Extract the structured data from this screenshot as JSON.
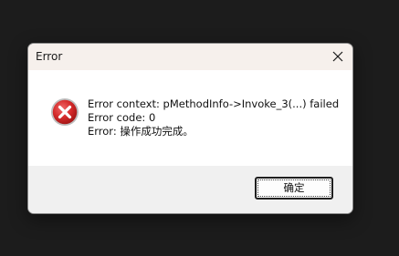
{
  "dialog": {
    "title": "Error",
    "icons": {
      "close": "close-icon",
      "status": "error-icon"
    },
    "colors": {
      "error_red": "#d32f2f",
      "titlebar": "#f6f0ec",
      "footer": "#f0f0f0"
    },
    "message": {
      "line1": "Error context: pMethodInfo->Invoke_3(...) failed",
      "line2": "Error code: 0",
      "line3": "Error: 操作成功完成。"
    },
    "ok_button_label": "确定"
  }
}
